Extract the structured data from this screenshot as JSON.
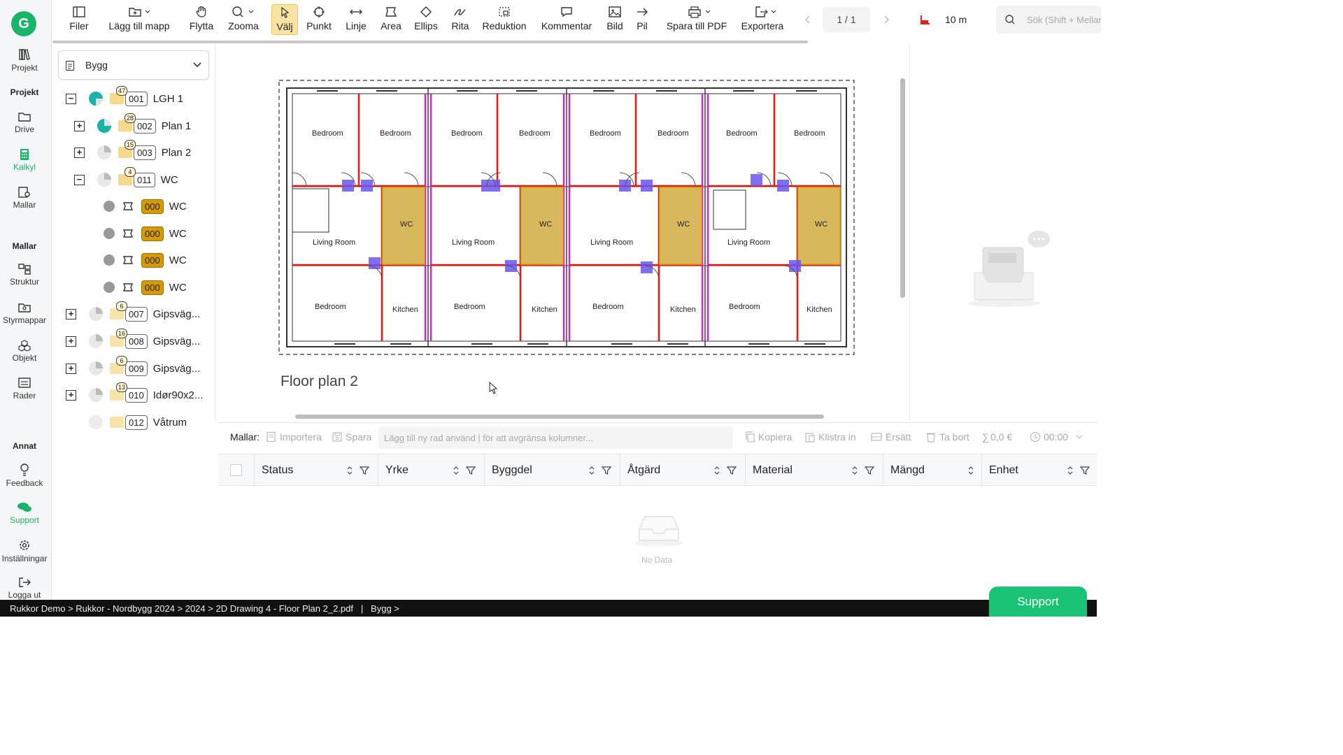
{
  "nav": {
    "logo": "G",
    "projekt": "Projekt",
    "projekt_head": "Projekt",
    "drive": "Drive",
    "kalkyl": "Kalkyl",
    "mallar": "Mallar",
    "mallar_head": "Mallar",
    "struktur": "Struktur",
    "styrmappar": "Styrmappar",
    "objekt": "Objekt",
    "rader": "Rader",
    "annat_head": "Annat",
    "feedback": "Feedback",
    "support": "Support",
    "installningar": "Inställningar",
    "logout": "Logga ut",
    "accent": "#19b468"
  },
  "toolbar": {
    "filer": "Filer",
    "lagg_till_mapp": "Lägg till mapp",
    "flytta": "Flytta",
    "zooma": "Zooma",
    "valj": "Välj",
    "punkt": "Punkt",
    "linje": "Linje",
    "area": "Area",
    "ellips": "Ellips",
    "rita": "Rita",
    "reduktion": "Reduktion",
    "kommentar": "Kommentar",
    "bild": "Bild",
    "pil": "Pil",
    "spara_pdf": "Spara till PDF",
    "exportera": "Exportera",
    "page": "1 / 1",
    "scale": "10 m",
    "search_placeholder": "Sök (Shift + Mellan"
  },
  "tree": {
    "selected": "Bygg",
    "rows": [
      {
        "badge": "47",
        "code": "001",
        "label": "LGH 1"
      },
      {
        "badge": "28",
        "code": "002",
        "label": "Plan 1"
      },
      {
        "badge": "15",
        "code": "003",
        "label": "Plan 2"
      },
      {
        "badge": "4",
        "code": "011",
        "label": "WC"
      },
      {
        "code": "000",
        "label": "WC"
      },
      {
        "code": "000",
        "label": "WC"
      },
      {
        "code": "000",
        "label": "WC"
      },
      {
        "code": "000",
        "label": "WC"
      },
      {
        "badge": "6",
        "code": "007",
        "label": "Gipsväg..."
      },
      {
        "badge": "16",
        "code": "008",
        "label": "Gipsväg..."
      },
      {
        "badge": "6",
        "code": "009",
        "label": "Gipsväg..."
      },
      {
        "badge": "13",
        "code": "010",
        "label": "Idør90x2..."
      },
      {
        "code": "012",
        "label": "Våtrum"
      }
    ]
  },
  "drawing": {
    "title": "Floor plan 2",
    "rooms": {
      "bedroom": "Bedroom",
      "living": "Living Room",
      "kitchen": "Kitchen",
      "wc": "WC"
    }
  },
  "bottom": {
    "mallar_label": "Mallar:",
    "importera": "Importera",
    "spara": "Spara",
    "input_placeholder": "Lägg till ny rad använd | för att avgränsa kolumner...",
    "kopiera": "Kopiera",
    "klistra_in": "Klistra in",
    "ersatt": "Ersätt",
    "ta_bort": "Ta bort",
    "sum": "0,0 €",
    "time": "00:00",
    "columns": [
      "Status",
      "Yrke",
      "Byggdel",
      "Åtgärd",
      "Material",
      "Mängd",
      "Enhet"
    ],
    "no_data": "No Data"
  },
  "status": {
    "breadcrumb": "Rukkor Demo > Rukkor - Nordbygg 2024 > 2024 > 2D Drawing 4 - Floor Plan 2_2.pdf   |   Bygg >",
    "support_button": "Support"
  }
}
